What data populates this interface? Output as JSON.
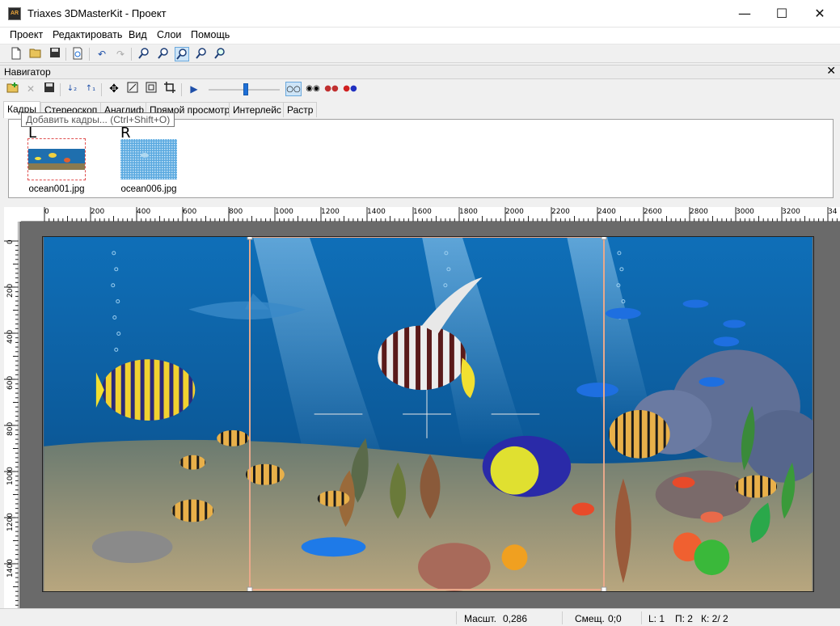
{
  "window": {
    "app_icon_text": "AR",
    "title": "Triaxes 3DMasterKit - Проект",
    "minimize_glyph": "—",
    "maximize_glyph": "☐",
    "close_glyph": "✕"
  },
  "menu": [
    {
      "label": "Проект"
    },
    {
      "label": "Редактировать"
    },
    {
      "label": "Вид"
    },
    {
      "label": "Слои"
    },
    {
      "label": "Помощь"
    }
  ],
  "toolbar": {
    "icons": [
      "new-file-icon",
      "open-folder-icon",
      "save-icon",
      "print-preview-icon",
      "undo-icon",
      "redo-icon",
      "zoom-in-icon",
      "zoom-out-icon",
      "zoom-fit-icon",
      "zoom-width-icon",
      "zoom-page-icon"
    ]
  },
  "navigator": {
    "title": "Навигатор",
    "close_glyph": "✕"
  },
  "tabs": [
    {
      "label": "Кадры",
      "active": true
    },
    {
      "label": "Стереоскоп",
      "active": false
    },
    {
      "label": "Анаглиф",
      "active": false
    },
    {
      "label": "Прямой просмотр",
      "active": false
    },
    {
      "label": "Интерлейс",
      "active": false
    },
    {
      "label": "Растр",
      "active": false
    }
  ],
  "tooltip": {
    "text": "Добавить кадры... (Ctrl+Shift+O)"
  },
  "frames": [
    {
      "letter": "L",
      "name": "ocean001.jpg"
    },
    {
      "letter": "R",
      "name": "ocean006.jpg"
    }
  ],
  "slider": {
    "value": 0.52
  },
  "ruler": {
    "h_labels": [
      "0",
      "200",
      "400",
      "600",
      "800",
      "1000",
      "1200",
      "1400",
      "1600",
      "1800",
      "2000",
      "2200",
      "2400",
      "2600",
      "2800",
      "3000",
      "3200",
      "34"
    ],
    "v_labels": [
      "0",
      "200",
      "400",
      "600",
      "800",
      "1000",
      "1200",
      "1400"
    ]
  },
  "status": {
    "scale_label": "Масшт.",
    "scale_value": "0,286",
    "offset_label": "Смещ.",
    "offset_value": "0;0",
    "l_value": "L: 1",
    "p_value": "П: 2",
    "k_value": "К: 2/ 2"
  },
  "colors": {
    "accent": "#1e6fd6",
    "frame_border": "#e8a88a",
    "water_top": "#1a7cc4",
    "water_bottom": "#0b3d75"
  }
}
